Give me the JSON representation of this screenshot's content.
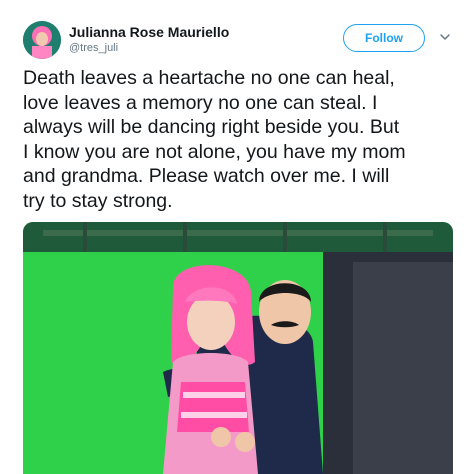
{
  "tweet": {
    "display_name": "Julianna Rose Mauriello",
    "username": "@tres_juli",
    "follow_label": "Follow",
    "text": "Death leaves a heartache no one can heal,\nlove leaves a memory no one can steal.  I\nalways will be dancing right beside you.  But\nI know you are not alone, you have my mom\nand grandma. Please watch over me. I will\ntry to stay strong."
  },
  "icons": {
    "avatar": "avatar",
    "menu": "chevron-down-icon"
  },
  "colors": {
    "accent": "#1da1f2",
    "text": "#14171a",
    "muted": "#657786",
    "greenscreen": "#2fd14a",
    "pink_hair": "#ff5fae",
    "costume_dark": "#1f2a4a"
  }
}
